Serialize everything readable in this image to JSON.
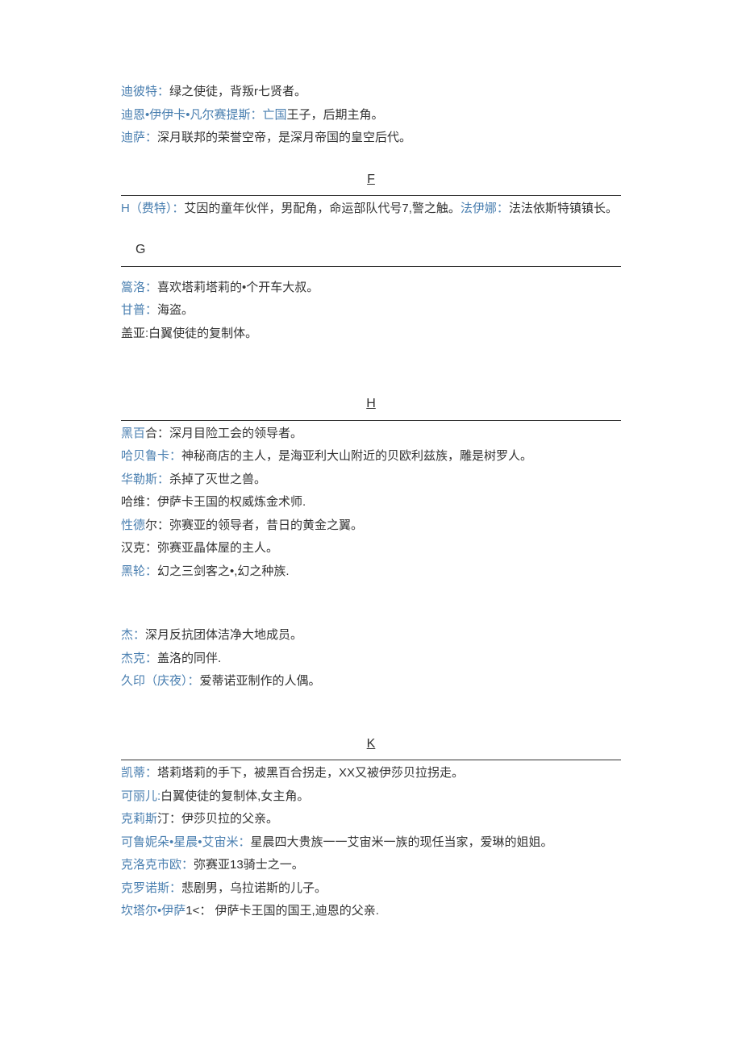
{
  "entries_top": [
    {
      "name": "迪彼特：",
      "desc": "绿之使徒，背叛r七贤者。"
    },
    {
      "name": "迪恩•伊伊卡•凡尔赛提斯：",
      "name2": "亡国",
      "desc": "王子，后期主角。"
    },
    {
      "name": "迪萨：",
      "desc": "深月联邦的荣誉空帝，是深月帝国的皇空后代。"
    }
  ],
  "section_F": "F",
  "f_line": {
    "name1": "H（费特）：",
    "desc1": "艾因的童年伙伴，男配角，命运部队代号7,警之触。",
    "name2": "法伊娜：",
    "desc2": "法法依斯特镇镇长。"
  },
  "section_G": "G",
  "entries_G": [
    {
      "name": "篙洛：",
      "desc": "喜欢塔莉塔莉的•个开车大叔。"
    },
    {
      "name": "甘普：",
      "desc": "海盗。"
    },
    {
      "name": "",
      "desc": "盖亚:白翼使徒的复制体。"
    }
  ],
  "section_H": "H",
  "entries_H": [
    {
      "name": "黑百",
      "desc": "合：深月目险工会的领导者。"
    },
    {
      "name": "哈贝鲁卡：",
      "desc": "神秘商店的主人，是海亚利大山附近的贝欧利兹族，雕是树罗人。"
    },
    {
      "name": "华勒斯：",
      "desc": "杀掉了灭世之兽。"
    },
    {
      "name": "",
      "desc": "哈维：伊萨卡王国的权威炼金术师."
    },
    {
      "name": "性德",
      "desc": "尔：弥赛亚的领导者，昔日的黄金之翼。"
    },
    {
      "name": "",
      "desc": "汉克：弥赛亚晶体屋的主人。"
    },
    {
      "name": "黑轮：",
      "desc": "幻之三剑客之•,幻之种族."
    }
  ],
  "entries_J": [
    {
      "name": "杰：",
      "desc": "深月反抗团体洁净大地成员。"
    },
    {
      "name": "杰克：",
      "desc": "盖洛的同伴."
    },
    {
      "name": "久印（庆夜）：",
      "desc": "爱蒂诺亚制作的人偶。"
    }
  ],
  "section_K": "K",
  "entries_K": [
    {
      "name": "凯蒂：",
      "desc": "塔莉塔莉的手下，被黑百合拐走，XX又被伊莎贝拉拐走。"
    },
    {
      "name": "可丽儿:",
      "desc": "白翼使徒的复制体,女主角。"
    },
    {
      "name": "克莉斯",
      "desc": "汀：伊莎贝拉的父亲。"
    },
    {
      "name": "可鲁妮朵•星晨•艾宙米：",
      "desc": "星晨四大贵族一一艾宙米一族的现任当家，爱琳的姐姐。"
    },
    {
      "name": "克洛克市欧：",
      "desc": "弥赛亚13骑士之一。"
    },
    {
      "name": "克罗诺斯：",
      "desc": "悲剧男，乌拉诺斯的儿子。"
    },
    {
      "name": "坎塔尔•伊萨",
      "desc": "1<： 伊萨卡王国的国王,迪恩的父亲."
    }
  ]
}
